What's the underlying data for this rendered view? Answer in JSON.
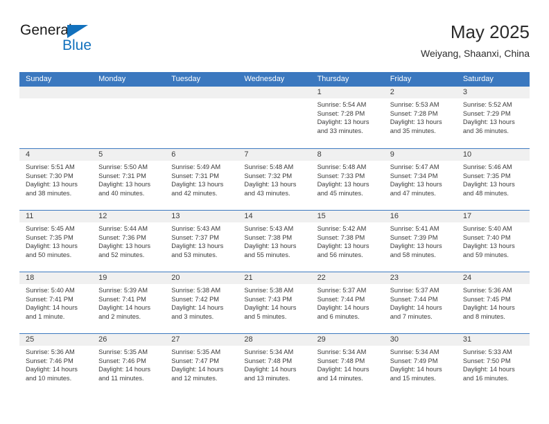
{
  "brand": {
    "name_top": "General",
    "name_bottom": "Blue",
    "triangle_color": "#1271bd",
    "text_color": "#1a1a1a"
  },
  "header": {
    "title": "May 2025",
    "location": "Weiyang, Shaanxi, China"
  },
  "theme": {
    "header_blue": "#3b78bf",
    "row_rule_blue": "#3b78bf",
    "number_band_gray": "#f0f0f0",
    "text_color": "#3a3a3a"
  },
  "weekdays": [
    "Sunday",
    "Monday",
    "Tuesday",
    "Wednesday",
    "Thursday",
    "Friday",
    "Saturday"
  ],
  "weeks": [
    [
      {
        "day": "",
        "lines": []
      },
      {
        "day": "",
        "lines": []
      },
      {
        "day": "",
        "lines": []
      },
      {
        "day": "",
        "lines": []
      },
      {
        "day": "1",
        "lines": [
          "Sunrise: 5:54 AM",
          "Sunset: 7:28 PM",
          "Daylight: 13 hours",
          "and 33 minutes."
        ]
      },
      {
        "day": "2",
        "lines": [
          "Sunrise: 5:53 AM",
          "Sunset: 7:28 PM",
          "Daylight: 13 hours",
          "and 35 minutes."
        ]
      },
      {
        "day": "3",
        "lines": [
          "Sunrise: 5:52 AM",
          "Sunset: 7:29 PM",
          "Daylight: 13 hours",
          "and 36 minutes."
        ]
      }
    ],
    [
      {
        "day": "4",
        "lines": [
          "Sunrise: 5:51 AM",
          "Sunset: 7:30 PM",
          "Daylight: 13 hours",
          "and 38 minutes."
        ]
      },
      {
        "day": "5",
        "lines": [
          "Sunrise: 5:50 AM",
          "Sunset: 7:31 PM",
          "Daylight: 13 hours",
          "and 40 minutes."
        ]
      },
      {
        "day": "6",
        "lines": [
          "Sunrise: 5:49 AM",
          "Sunset: 7:31 PM",
          "Daylight: 13 hours",
          "and 42 minutes."
        ]
      },
      {
        "day": "7",
        "lines": [
          "Sunrise: 5:48 AM",
          "Sunset: 7:32 PM",
          "Daylight: 13 hours",
          "and 43 minutes."
        ]
      },
      {
        "day": "8",
        "lines": [
          "Sunrise: 5:48 AM",
          "Sunset: 7:33 PM",
          "Daylight: 13 hours",
          "and 45 minutes."
        ]
      },
      {
        "day": "9",
        "lines": [
          "Sunrise: 5:47 AM",
          "Sunset: 7:34 PM",
          "Daylight: 13 hours",
          "and 47 minutes."
        ]
      },
      {
        "day": "10",
        "lines": [
          "Sunrise: 5:46 AM",
          "Sunset: 7:35 PM",
          "Daylight: 13 hours",
          "and 48 minutes."
        ]
      }
    ],
    [
      {
        "day": "11",
        "lines": [
          "Sunrise: 5:45 AM",
          "Sunset: 7:35 PM",
          "Daylight: 13 hours",
          "and 50 minutes."
        ]
      },
      {
        "day": "12",
        "lines": [
          "Sunrise: 5:44 AM",
          "Sunset: 7:36 PM",
          "Daylight: 13 hours",
          "and 52 minutes."
        ]
      },
      {
        "day": "13",
        "lines": [
          "Sunrise: 5:43 AM",
          "Sunset: 7:37 PM",
          "Daylight: 13 hours",
          "and 53 minutes."
        ]
      },
      {
        "day": "14",
        "lines": [
          "Sunrise: 5:43 AM",
          "Sunset: 7:38 PM",
          "Daylight: 13 hours",
          "and 55 minutes."
        ]
      },
      {
        "day": "15",
        "lines": [
          "Sunrise: 5:42 AM",
          "Sunset: 7:38 PM",
          "Daylight: 13 hours",
          "and 56 minutes."
        ]
      },
      {
        "day": "16",
        "lines": [
          "Sunrise: 5:41 AM",
          "Sunset: 7:39 PM",
          "Daylight: 13 hours",
          "and 58 minutes."
        ]
      },
      {
        "day": "17",
        "lines": [
          "Sunrise: 5:40 AM",
          "Sunset: 7:40 PM",
          "Daylight: 13 hours",
          "and 59 minutes."
        ]
      }
    ],
    [
      {
        "day": "18",
        "lines": [
          "Sunrise: 5:40 AM",
          "Sunset: 7:41 PM",
          "Daylight: 14 hours",
          "and 1 minute."
        ]
      },
      {
        "day": "19",
        "lines": [
          "Sunrise: 5:39 AM",
          "Sunset: 7:41 PM",
          "Daylight: 14 hours",
          "and 2 minutes."
        ]
      },
      {
        "day": "20",
        "lines": [
          "Sunrise: 5:38 AM",
          "Sunset: 7:42 PM",
          "Daylight: 14 hours",
          "and 3 minutes."
        ]
      },
      {
        "day": "21",
        "lines": [
          "Sunrise: 5:38 AM",
          "Sunset: 7:43 PM",
          "Daylight: 14 hours",
          "and 5 minutes."
        ]
      },
      {
        "day": "22",
        "lines": [
          "Sunrise: 5:37 AM",
          "Sunset: 7:44 PM",
          "Daylight: 14 hours",
          "and 6 minutes."
        ]
      },
      {
        "day": "23",
        "lines": [
          "Sunrise: 5:37 AM",
          "Sunset: 7:44 PM",
          "Daylight: 14 hours",
          "and 7 minutes."
        ]
      },
      {
        "day": "24",
        "lines": [
          "Sunrise: 5:36 AM",
          "Sunset: 7:45 PM",
          "Daylight: 14 hours",
          "and 8 minutes."
        ]
      }
    ],
    [
      {
        "day": "25",
        "lines": [
          "Sunrise: 5:36 AM",
          "Sunset: 7:46 PM",
          "Daylight: 14 hours",
          "and 10 minutes."
        ]
      },
      {
        "day": "26",
        "lines": [
          "Sunrise: 5:35 AM",
          "Sunset: 7:46 PM",
          "Daylight: 14 hours",
          "and 11 minutes."
        ]
      },
      {
        "day": "27",
        "lines": [
          "Sunrise: 5:35 AM",
          "Sunset: 7:47 PM",
          "Daylight: 14 hours",
          "and 12 minutes."
        ]
      },
      {
        "day": "28",
        "lines": [
          "Sunrise: 5:34 AM",
          "Sunset: 7:48 PM",
          "Daylight: 14 hours",
          "and 13 minutes."
        ]
      },
      {
        "day": "29",
        "lines": [
          "Sunrise: 5:34 AM",
          "Sunset: 7:48 PM",
          "Daylight: 14 hours",
          "and 14 minutes."
        ]
      },
      {
        "day": "30",
        "lines": [
          "Sunrise: 5:34 AM",
          "Sunset: 7:49 PM",
          "Daylight: 14 hours",
          "and 15 minutes."
        ]
      },
      {
        "day": "31",
        "lines": [
          "Sunrise: 5:33 AM",
          "Sunset: 7:50 PM",
          "Daylight: 14 hours",
          "and 16 minutes."
        ]
      }
    ]
  ]
}
